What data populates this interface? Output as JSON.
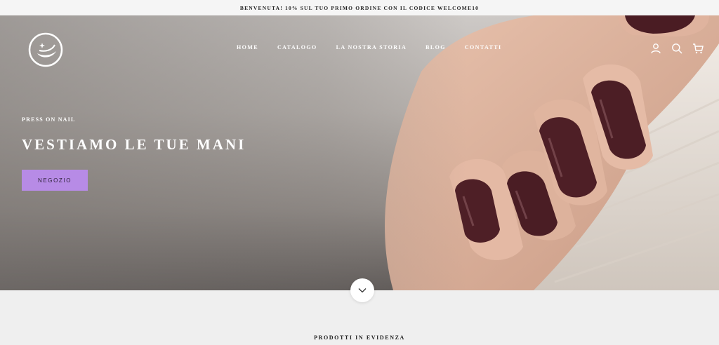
{
  "announcement": {
    "text": "BENVENUTA!  10% SUL TUO PRIMO ORDINE CON IL CODICE WELCOME10"
  },
  "nav": {
    "items": [
      {
        "label": "HOME"
      },
      {
        "label": "CATALOGO"
      },
      {
        "label": "LA NOSTRA STORIA"
      },
      {
        "label": "BLOG"
      },
      {
        "label": "CONTATTI"
      }
    ]
  },
  "header_icons": [
    "user-icon",
    "search-icon",
    "cart-icon"
  ],
  "hero": {
    "eyebrow": "PRESS ON NAIL",
    "headline": "VESTIAMO LE TUE MANI",
    "cta_label": "NEGOZIO"
  },
  "featured": {
    "title": "PRODOTTI IN EVIDENZA"
  },
  "colors": {
    "cta_background": "#b78be6",
    "nail_polish": "#4e1f26",
    "page_background": "#efefef"
  }
}
